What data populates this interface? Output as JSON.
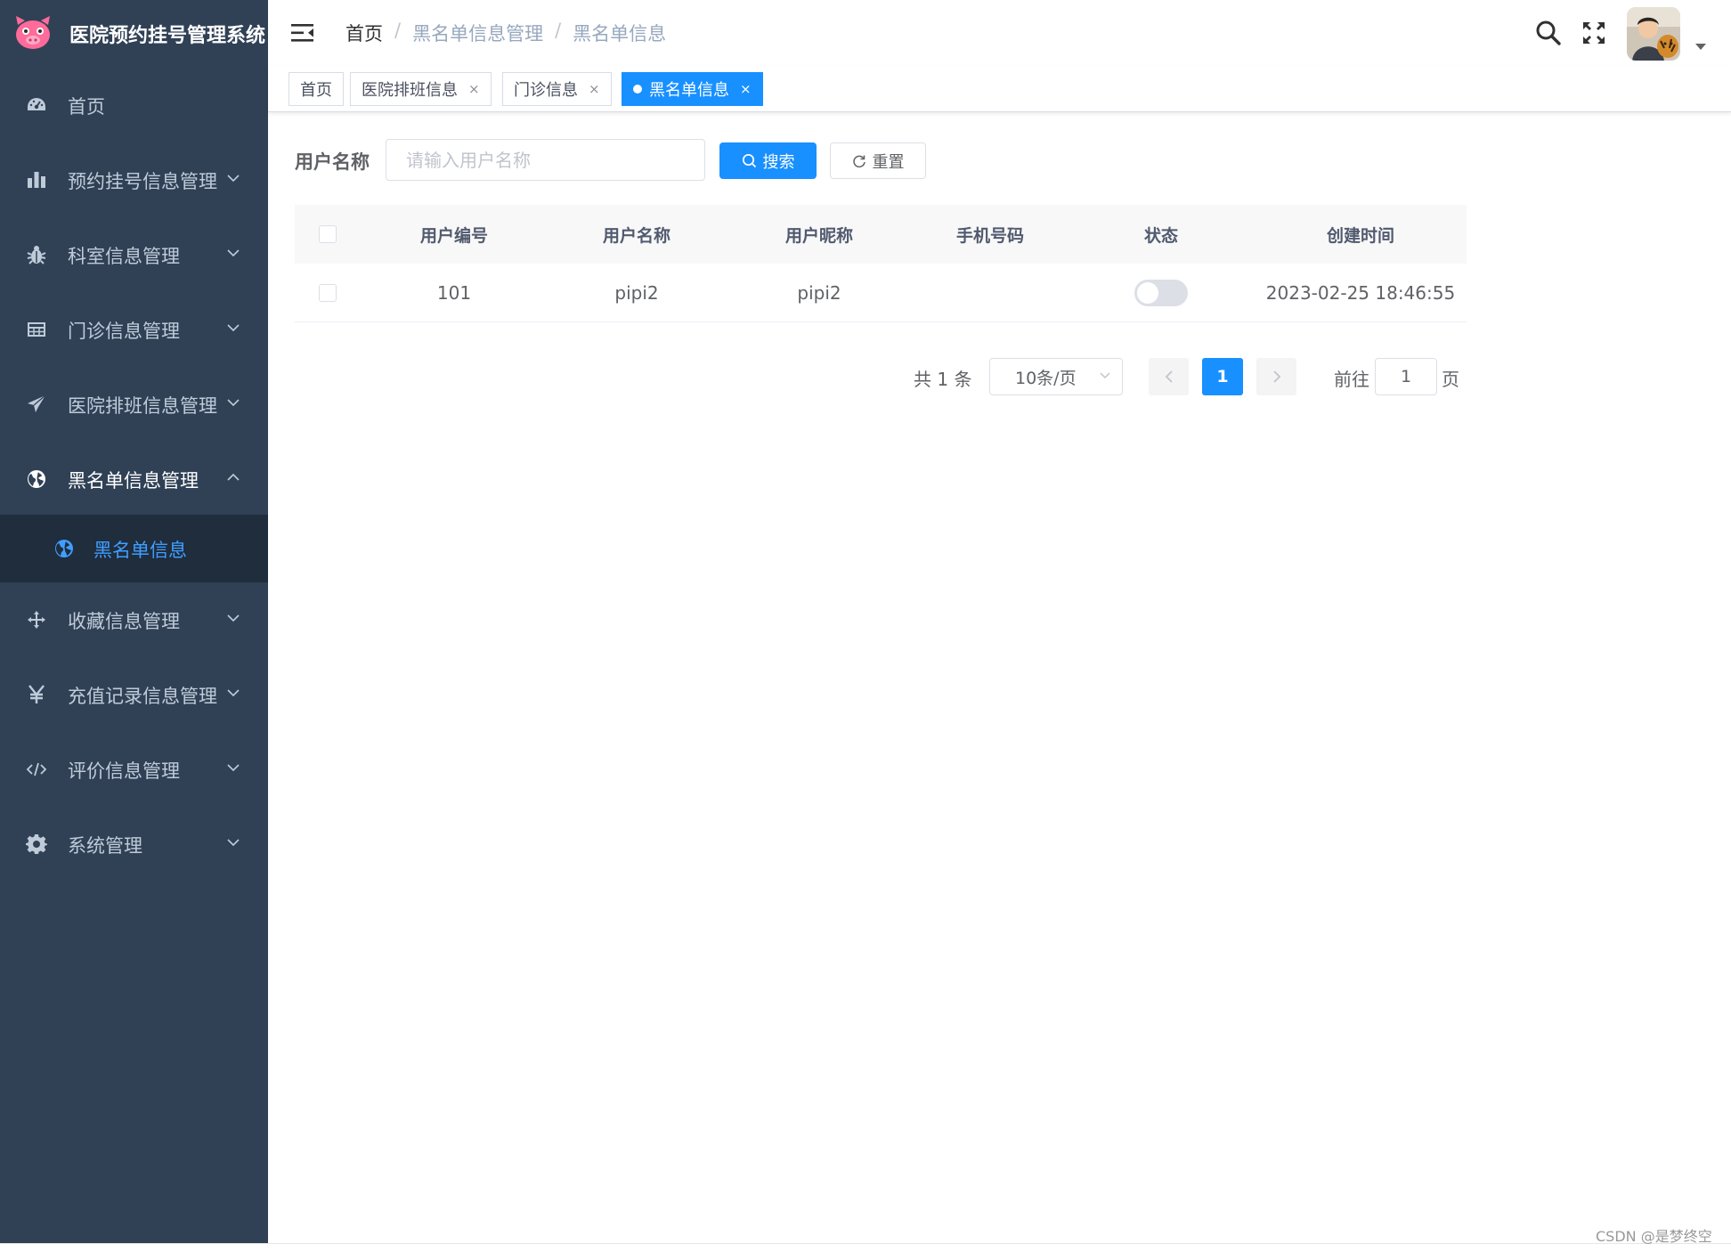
{
  "app": {
    "title": "医院预约挂号管理系统",
    "logo_icon": "pig-face-icon"
  },
  "sidebar": {
    "items": [
      {
        "label": "首页",
        "icon": "dashboard-icon",
        "has_arrow": false
      },
      {
        "label": "预约挂号信息管理",
        "icon": "bar-chart-icon",
        "has_arrow": true
      },
      {
        "label": "科室信息管理",
        "icon": "bug-icon",
        "has_arrow": true
      },
      {
        "label": "门诊信息管理",
        "icon": "table-icon",
        "has_arrow": true
      },
      {
        "label": "医院排班信息管理",
        "icon": "paper-plane-icon",
        "has_arrow": true
      },
      {
        "label": "黑名单信息管理",
        "icon": "globe-icon",
        "has_arrow": true,
        "expanded": true
      },
      {
        "label": "收藏信息管理",
        "icon": "move-icon",
        "has_arrow": true
      },
      {
        "label": "充值记录信息管理",
        "icon": "yen-icon",
        "has_arrow": true
      },
      {
        "label": "评价信息管理",
        "icon": "code-icon",
        "has_arrow": true
      },
      {
        "label": "系统管理",
        "icon": "gear-icon",
        "has_arrow": true
      }
    ],
    "sub_item": {
      "label": "黑名单信息",
      "icon": "globe-icon",
      "active": true
    },
    "colors": {
      "bg": "#304156",
      "text": "#bfcbd9",
      "active": "#409eff",
      "submenu_bg": "#1f2d3d"
    }
  },
  "navbar": {
    "breadcrumb": [
      "首页",
      "黑名单信息管理",
      "黑名单信息"
    ],
    "separator": "/",
    "icons": [
      "hamburger-icon",
      "search-icon",
      "fullscreen-icon",
      "avatar",
      "caret-down-icon"
    ]
  },
  "tags": [
    {
      "label": "首页",
      "closable": false,
      "active": false
    },
    {
      "label": "医院排班信息",
      "closable": true,
      "active": false
    },
    {
      "label": "门诊信息",
      "closable": true,
      "active": false
    },
    {
      "label": "黑名单信息",
      "closable": true,
      "active": true
    }
  ],
  "tag_close_glyph": "×",
  "search": {
    "label": "用户名称",
    "placeholder": "请输入用户名称",
    "value": "",
    "search_button": "搜索",
    "reset_button": "重置"
  },
  "table": {
    "columns": [
      "用户编号",
      "用户名称",
      "用户昵称",
      "手机号码",
      "状态",
      "创建时间"
    ],
    "rows": [
      {
        "id": "101",
        "username": "pipi2",
        "nickname": "pipi2",
        "phone": "",
        "status_on": false,
        "created": "2023-02-25 18:46:55"
      }
    ]
  },
  "pagination": {
    "total_text": "共 1 条",
    "page_size": "10条/页",
    "current_page": "1",
    "goto_label": "前往",
    "goto_value": "1",
    "goto_suffix": "页"
  },
  "watermark": "CSDN @是梦终空",
  "colors": {
    "primary": "#1890ff",
    "border": "#dcdfe6",
    "header_bg": "#f8f8f9"
  }
}
